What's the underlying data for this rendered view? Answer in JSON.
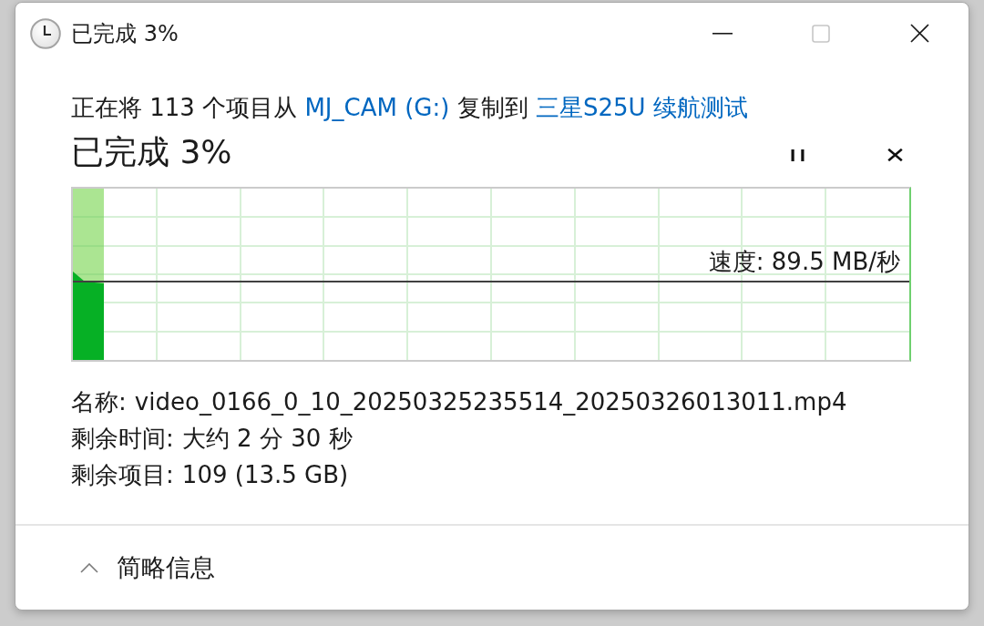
{
  "window": {
    "title": "已完成 3%",
    "controls": [
      {
        "kind": "minimize",
        "disabled": false
      },
      {
        "kind": "maximize",
        "disabled": true
      },
      {
        "kind": "close",
        "disabled": false
      }
    ]
  },
  "summary": [
    {
      "kind": "text",
      "text": "正在将 113 个项目从"
    },
    {
      "kind": "link",
      "text": "MJ_CAM (G:)"
    },
    {
      "kind": "text",
      "text": "复制到"
    },
    {
      "kind": "link",
      "text": "三星S25U 续航测试"
    }
  ],
  "progress": {
    "heading": "已完成 3%",
    "actions": [
      {
        "kind": "pause"
      },
      {
        "kind": "cancel"
      }
    ],
    "level": 0.037,
    "speed": "速度: 89.5 MB/秒"
  },
  "details": [
    {
      "label": "名称:",
      "value": "video_0166_0_10_20250325235514_20250326013011.mp4"
    },
    {
      "label": "剩余时间:",
      "value": "大约 2 分 30 秒"
    },
    {
      "label": "剩余项目:",
      "value": "109 (13.5 GB)"
    }
  ],
  "footer": {
    "toggle": {
      "label": "简略信息",
      "expanded": true
    }
  }
}
